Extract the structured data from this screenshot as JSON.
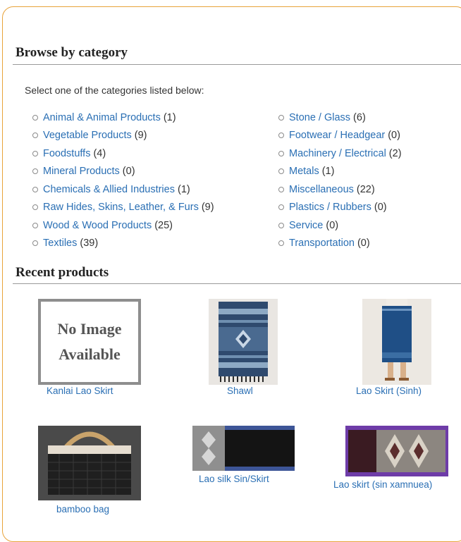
{
  "browse": {
    "title": "Browse by category",
    "intro": "Select one of the categories listed below:",
    "left_categories": [
      {
        "name": "Animal & Animal Products",
        "count": "(1)"
      },
      {
        "name": "Vegetable Products",
        "count": "(9)"
      },
      {
        "name": "Foodstuffs",
        "count": "(4)"
      },
      {
        "name": "Mineral Products",
        "count": "(0)"
      },
      {
        "name": "Chemicals & Allied Industries",
        "count": "(1)"
      },
      {
        "name": "Raw Hides, Skins, Leather, & Furs",
        "count": "(9)"
      },
      {
        "name": "Wood & Wood Products",
        "count": "(25)"
      },
      {
        "name": "Textiles",
        "count": "(39)"
      }
    ],
    "right_categories": [
      {
        "name": "Stone / Glass",
        "count": "(6)"
      },
      {
        "name": "Footwear / Headgear",
        "count": "(0)"
      },
      {
        "name": "Machinery / Electrical",
        "count": "(2)"
      },
      {
        "name": "Metals",
        "count": "(1)"
      },
      {
        "name": "Miscellaneous",
        "count": "(22)"
      },
      {
        "name": "Plastics / Rubbers",
        "count": "(0)"
      },
      {
        "name": "Service",
        "count": "(0)"
      },
      {
        "name": "Transportation",
        "count": "(0)"
      }
    ]
  },
  "recent": {
    "title": "Recent products",
    "no_image": {
      "line1": "No Image",
      "line2": "Available"
    },
    "products": [
      {
        "name": "Kanlai Lao Skirt"
      },
      {
        "name": "Shawl"
      },
      {
        "name": "Lao Skirt (Sinh)"
      },
      {
        "name": "bamboo bag"
      },
      {
        "name": "Lao silk Sin/Skirt"
      },
      {
        "name": "Lao skirt (sin xamnuea)"
      }
    ]
  },
  "colors": {
    "panel_border": "#e8a33a",
    "link": "#2a6fb4",
    "text": "#333333"
  }
}
